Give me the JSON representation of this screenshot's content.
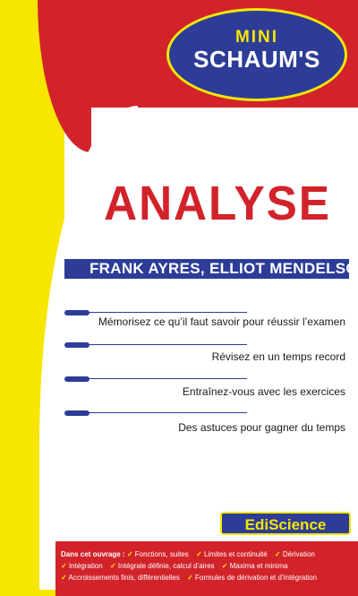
{
  "cover": {
    "logo_mini": "MINI",
    "logo_schaums": "SCHAUM'S",
    "title": "ANALYSE",
    "authors": "FRANK AYRES, ELLIOT MENDELSON",
    "bullets": [
      "Mémorisez ce qu’il faut savoir pour réussir l’examen",
      "Révisez en un temps record",
      "Entraînez-vous avec les exercices",
      "Des astuces pour gagner du temps"
    ],
    "publisher": "EdiScience",
    "contents_label": "Dans cet ouvrage :",
    "contents_items": [
      "Fonctions, suites",
      "Limites et continuité",
      "Dérivation",
      "Intégration",
      "Intégrale définie, calcul d’aires",
      "Maxima et minima",
      "Accroissements finis, différentielles",
      "Formules de dérivation et d’intégration"
    ],
    "colors": {
      "red": "#d2232a",
      "yellow": "#f6e600",
      "blue": "#2d3c97"
    }
  }
}
